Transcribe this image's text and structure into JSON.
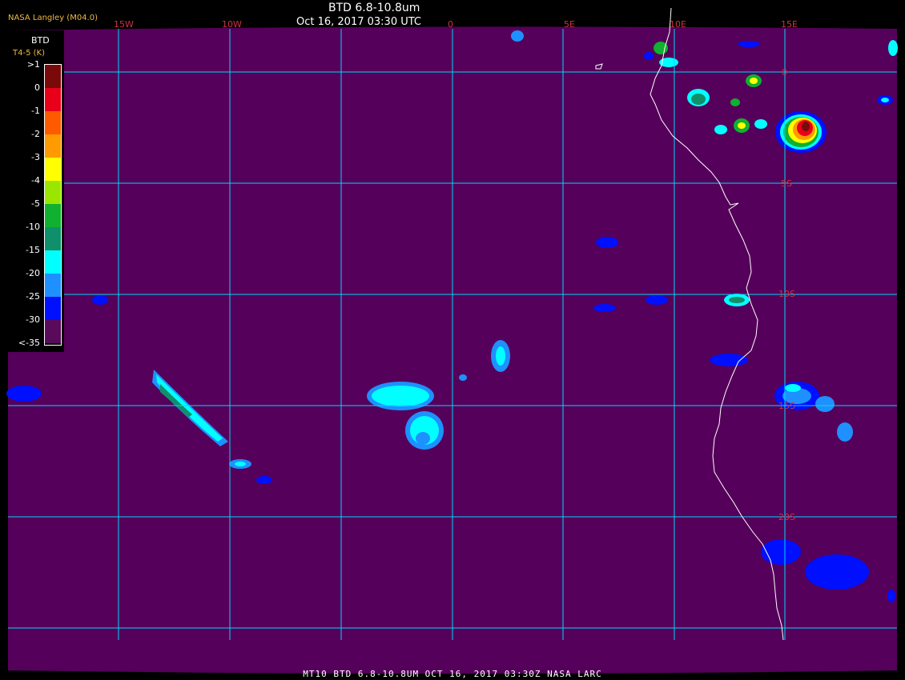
{
  "header": {
    "source": "NASA Langley (M04.0)",
    "title": "BTD 6.8-10.8um",
    "datetime": "Oct 16, 2017 03:30 UTC"
  },
  "footer": {
    "caption": "MT10  BTD 6.8-10.8UM  OCT 16, 2017 03:30Z  NASA LARC"
  },
  "legend": {
    "title": "BTD",
    "subtitle": "T4-5 (K)",
    "ticks": [
      ">1",
      "0",
      "-1",
      "-2",
      "-3",
      "-4",
      "-5",
      "-10",
      "-15",
      "-20",
      "-25",
      "-30",
      "<-35"
    ],
    "colors": [
      "#7a0a0a",
      "#e8001a",
      "#ff5a00",
      "#ff9a00",
      "#ffff00",
      "#9be600",
      "#10b030",
      "#10906a",
      "#00ffff",
      "#1e90ff",
      "#0010ff",
      "#5a0a5a"
    ]
  },
  "grid": {
    "lon_labels": [
      "15W",
      "10W",
      "0",
      "5E",
      "10E",
      "15E"
    ],
    "lat_labels": [
      "0",
      "5S",
      "10S",
      "15S",
      "20S"
    ]
  },
  "colors": {
    "background": "#55005a",
    "grid": "#00d8ff",
    "coastline": "#ffffff",
    "grid_label": "#cc3344"
  }
}
